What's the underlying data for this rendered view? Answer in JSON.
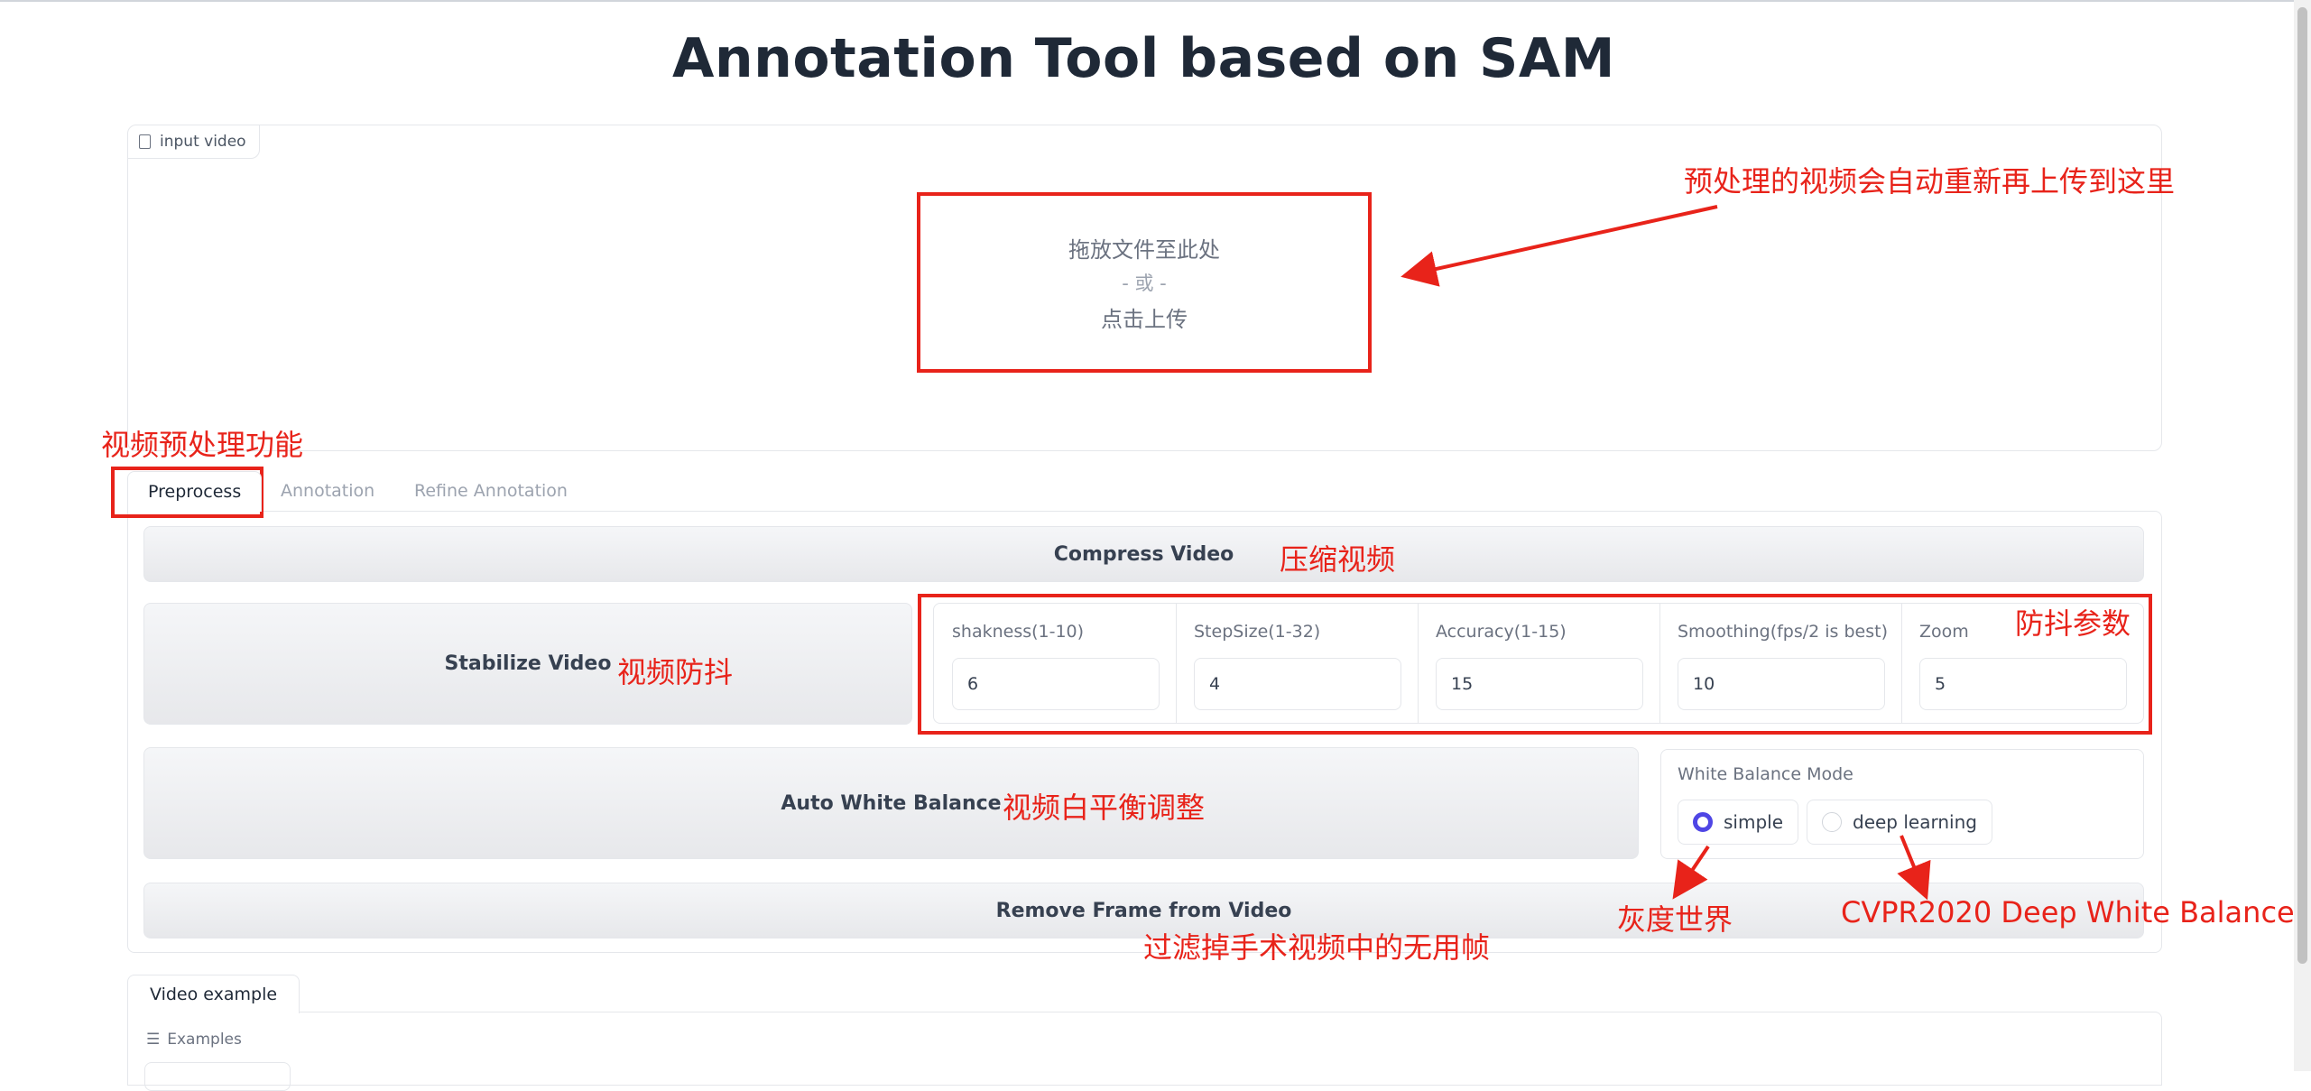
{
  "page": {
    "title": "Annotation Tool based on SAM"
  },
  "upload": {
    "label": "input video",
    "drop_line1": "拖放文件至此处",
    "drop_line2": "- 或 -",
    "drop_line3": "点击上传"
  },
  "tabs": [
    {
      "label": "Preprocess",
      "active": true
    },
    {
      "label": "Annotation",
      "active": false
    },
    {
      "label": "Refine Annotation",
      "active": false
    }
  ],
  "preprocess": {
    "compress_button": "Compress Video",
    "stabilize_button": "Stabilize Video",
    "params": [
      {
        "label": "shakness(1-10)",
        "value": "6"
      },
      {
        "label": "StepSize(1-32)",
        "value": "4"
      },
      {
        "label": "Accuracy(1-15)",
        "value": "15"
      },
      {
        "label": "Smoothing(fps/2 is best)",
        "value": "10"
      },
      {
        "label": "Zoom",
        "value": "5"
      }
    ],
    "white_balance_button": "Auto White Balance",
    "white_balance_mode": {
      "label": "White Balance Mode",
      "options": [
        "simple",
        "deep learning"
      ],
      "selected": "simple"
    },
    "remove_frame_button": "Remove Frame from Video"
  },
  "examples": {
    "tab_label": "Video example",
    "section_label": "Examples"
  },
  "annotations": {
    "upload_note": "预处理的视频会自动重新再上传到这里",
    "preprocess_note": "视频预处理功能",
    "compress_note": "压缩视频",
    "stabilize_note": "视频防抖",
    "params_note": "防抖参数",
    "white_balance_note": "视频白平衡调整",
    "simple_note": "灰度世界",
    "deep_note": "CVPR2020 Deep White Balance",
    "remove_note": "过滤掉手术视频中的无用帧"
  },
  "colors": {
    "annotation": "#e8231a",
    "radio_selected": "#4f46e5"
  }
}
